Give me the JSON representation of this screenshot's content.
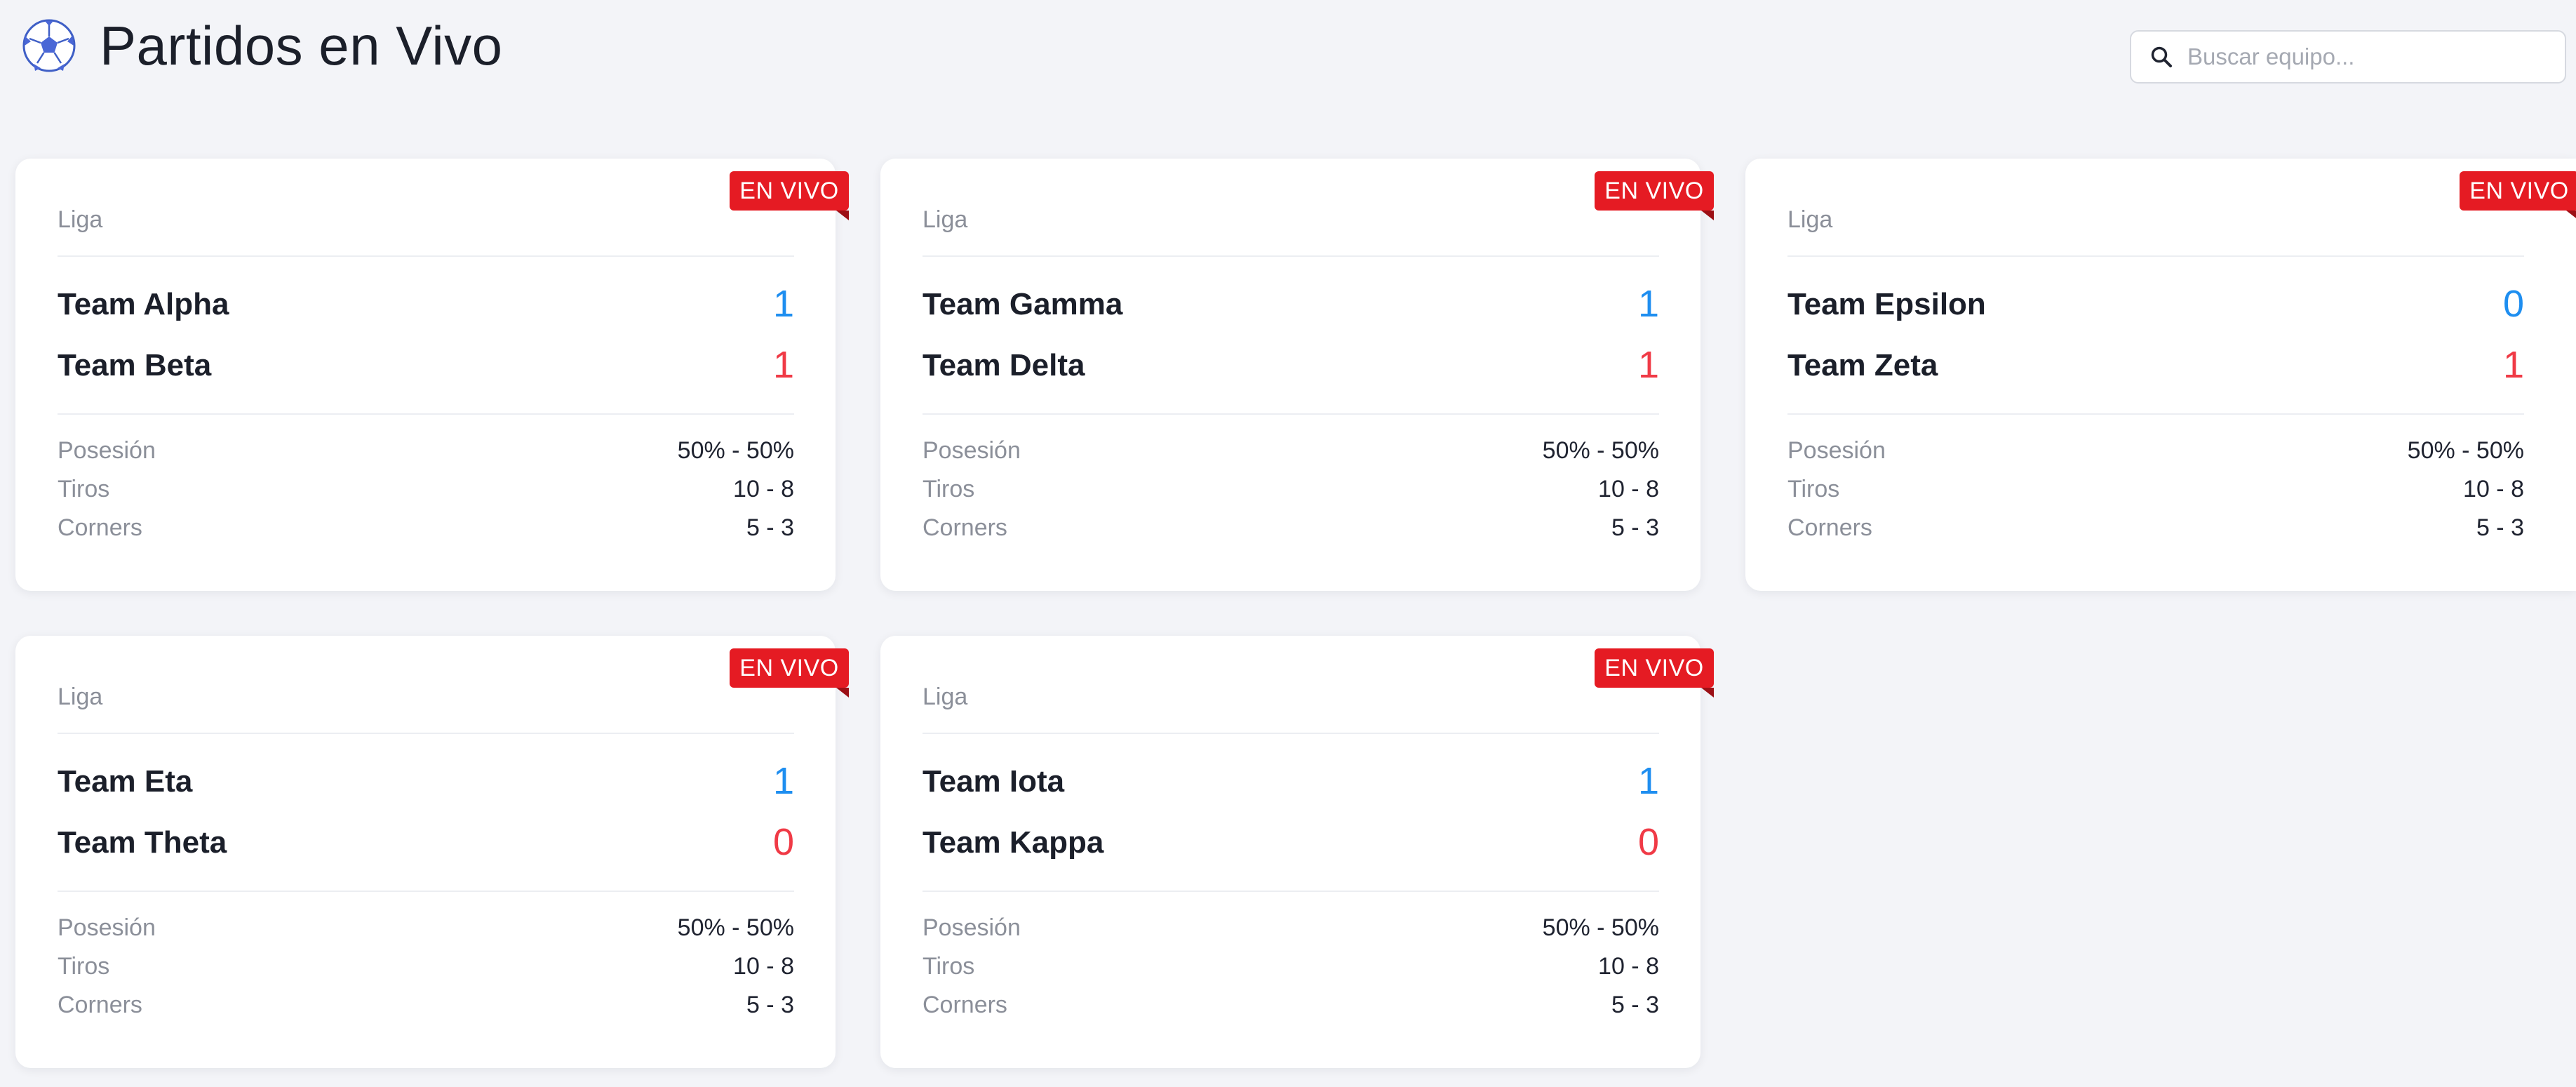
{
  "header": {
    "title": "Partidos en Vivo",
    "icon": "soccer-ball-icon"
  },
  "search": {
    "placeholder": "Buscar equipo...",
    "value": "",
    "icon": "search-icon"
  },
  "colors": {
    "home_score": "#1e8ef0",
    "away_score": "#f03a46",
    "live_badge": "#e51b23",
    "background": "#f3f4f8"
  },
  "matches": [
    {
      "badge": "EN VIVO",
      "league": "Liga",
      "home": {
        "name": "Team Alpha",
        "score": "1"
      },
      "away": {
        "name": "Team Beta",
        "score": "1"
      },
      "stats": [
        {
          "label": "Posesión",
          "value": "50% - 50%"
        },
        {
          "label": "Tiros",
          "value": "10 - 8"
        },
        {
          "label": "Corners",
          "value": "5 - 3"
        }
      ]
    },
    {
      "badge": "EN VIVO",
      "league": "Liga",
      "home": {
        "name": "Team Gamma",
        "score": "1"
      },
      "away": {
        "name": "Team Delta",
        "score": "1"
      },
      "stats": [
        {
          "label": "Posesión",
          "value": "50% - 50%"
        },
        {
          "label": "Tiros",
          "value": "10 - 8"
        },
        {
          "label": "Corners",
          "value": "5 - 3"
        }
      ]
    },
    {
      "badge": "EN VIVO",
      "league": "Liga",
      "home": {
        "name": "Team Epsilon",
        "score": "0"
      },
      "away": {
        "name": "Team Zeta",
        "score": "1"
      },
      "stats": [
        {
          "label": "Posesión",
          "value": "50% - 50%"
        },
        {
          "label": "Tiros",
          "value": "10 - 8"
        },
        {
          "label": "Corners",
          "value": "5 - 3"
        }
      ]
    },
    {
      "badge": "EN VIVO",
      "league": "Liga",
      "home": {
        "name": "Team Eta",
        "score": "1"
      },
      "away": {
        "name": "Team Theta",
        "score": "0"
      },
      "stats": [
        {
          "label": "Posesión",
          "value": "50% - 50%"
        },
        {
          "label": "Tiros",
          "value": "10 - 8"
        },
        {
          "label": "Corners",
          "value": "5 - 3"
        }
      ]
    },
    {
      "badge": "EN VIVO",
      "league": "Liga",
      "home": {
        "name": "Team Iota",
        "score": "1"
      },
      "away": {
        "name": "Team Kappa",
        "score": "0"
      },
      "stats": [
        {
          "label": "Posesión",
          "value": "50% - 50%"
        },
        {
          "label": "Tiros",
          "value": "10 - 8"
        },
        {
          "label": "Corners",
          "value": "5 - 3"
        }
      ]
    }
  ]
}
